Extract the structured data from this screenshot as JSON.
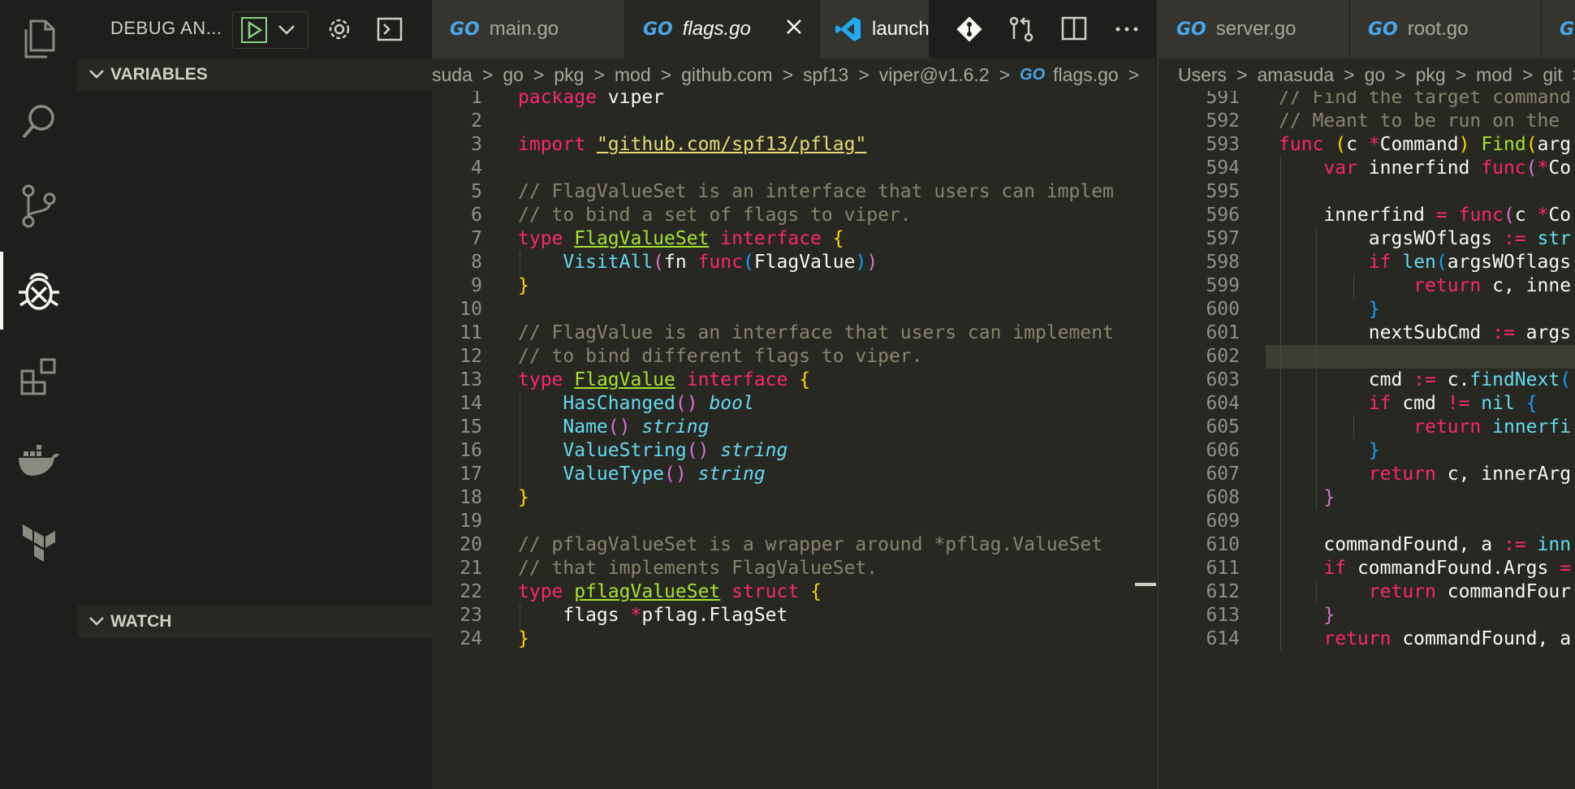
{
  "activity_bar": {
    "items": [
      "explorer-icon",
      "search-icon",
      "source-control-icon",
      "debug-icon",
      "extensions-icon",
      "docker-icon",
      "terraform-icon"
    ],
    "active": "debug-icon"
  },
  "debug": {
    "title": "DEBUG AN...",
    "sections": [
      {
        "label": "VARIABLES"
      },
      {
        "label": "WATCH"
      }
    ]
  },
  "left_editor": {
    "tabs": [
      {
        "label": "main.go",
        "active": false
      },
      {
        "label": "flags.go",
        "active": true
      },
      {
        "label": "launch",
        "active": false
      }
    ],
    "breadcrumb": [
      "suda",
      "go",
      "pkg",
      "mod",
      "github.com",
      "spf13",
      "viper@v1.6.2",
      "flags.go"
    ],
    "line_numbers": [
      "1",
      "2",
      "3",
      "4",
      "5",
      "6",
      "7",
      "8",
      "9",
      "10",
      "11",
      "12",
      "13",
      "14",
      "15",
      "16",
      "17",
      "18",
      "19",
      "20",
      "21",
      "22",
      "23",
      "24"
    ],
    "lines": [
      [
        [
          "kw",
          "package"
        ],
        [
          "pl",
          " viper"
        ]
      ],
      [],
      [
        [
          "kw",
          "import"
        ],
        [
          "pl",
          " "
        ],
        [
          "st",
          "\"github.com/spf13/pflag\"",
          "u"
        ]
      ],
      [],
      [
        [
          "cm",
          "// FlagValueSet is an interface that users can implem"
        ]
      ],
      [
        [
          "cm",
          "// to bind a set of flags to viper."
        ]
      ],
      [
        [
          "kw",
          "type"
        ],
        [
          "pl",
          " "
        ],
        [
          "fn",
          "FlagValueSet",
          "u"
        ],
        [
          "pl",
          " "
        ],
        [
          "kw",
          "interface"
        ],
        [
          "pl",
          " "
        ],
        [
          "br1",
          "{"
        ]
      ],
      [
        [
          "pl",
          "    "
        ],
        [
          "cl",
          "VisitAll"
        ],
        [
          "br2",
          "("
        ],
        [
          "pl",
          "fn "
        ],
        [
          "kw",
          "func"
        ],
        [
          "br3",
          "("
        ],
        [
          "pl",
          "FlagValue"
        ],
        [
          "br3",
          ")"
        ],
        [
          "br2",
          ")"
        ]
      ],
      [
        [
          "br1",
          "}"
        ]
      ],
      [],
      [
        [
          "cm",
          "// FlagValue is an interface that users can implement"
        ]
      ],
      [
        [
          "cm",
          "// to bind different flags to viper."
        ]
      ],
      [
        [
          "kw",
          "type"
        ],
        [
          "pl",
          " "
        ],
        [
          "fn",
          "FlagValue",
          "u"
        ],
        [
          "pl",
          " "
        ],
        [
          "kw",
          "interface"
        ],
        [
          "pl",
          " "
        ],
        [
          "br1",
          "{"
        ]
      ],
      [
        [
          "pl",
          "    "
        ],
        [
          "cl",
          "HasChanged"
        ],
        [
          "br2",
          "()"
        ],
        [
          "pl",
          " "
        ],
        [
          "ty",
          "bool"
        ]
      ],
      [
        [
          "pl",
          "    "
        ],
        [
          "cl",
          "Name"
        ],
        [
          "br2",
          "()"
        ],
        [
          "pl",
          " "
        ],
        [
          "ty",
          "string"
        ]
      ],
      [
        [
          "pl",
          "    "
        ],
        [
          "cl",
          "ValueString"
        ],
        [
          "br2",
          "()"
        ],
        [
          "pl",
          " "
        ],
        [
          "ty",
          "string"
        ]
      ],
      [
        [
          "pl",
          "    "
        ],
        [
          "cl",
          "ValueType"
        ],
        [
          "br2",
          "()"
        ],
        [
          "pl",
          " "
        ],
        [
          "ty",
          "string"
        ]
      ],
      [
        [
          "br1",
          "}"
        ]
      ],
      [],
      [
        [
          "cm",
          "// pflagValueSet is a wrapper around *pflag.ValueSet"
        ]
      ],
      [
        [
          "cm",
          "// that implements FlagValueSet."
        ]
      ],
      [
        [
          "kw",
          "type"
        ],
        [
          "pl",
          " "
        ],
        [
          "fn",
          "pflagValueSet",
          "u"
        ],
        [
          "pl",
          " "
        ],
        [
          "kw",
          "struct"
        ],
        [
          "pl",
          " "
        ],
        [
          "br1",
          "{"
        ]
      ],
      [
        [
          "pl",
          "    flags "
        ],
        [
          "kw",
          "*"
        ],
        [
          "pl",
          "pflag.FlagSet"
        ]
      ],
      [
        [
          "br1",
          "}"
        ]
      ]
    ]
  },
  "right_editor": {
    "tabs": [
      {
        "label": "server.go",
        "active": false
      },
      {
        "label": "root.go",
        "active": false
      }
    ],
    "breadcrumb": [
      "Users",
      "amasuda",
      "go",
      "pkg",
      "mod",
      "git"
    ],
    "line_numbers": [
      "591",
      "592",
      "593",
      "594",
      "595",
      "596",
      "597",
      "598",
      "599",
      "600",
      "601",
      "602",
      "603",
      "604",
      "605",
      "606",
      "607",
      "608",
      "609",
      "610",
      "611",
      "612",
      "613",
      "614"
    ],
    "breakpoint_line": "601",
    "lines": [
      [
        [
          "cm",
          "// Find the target command"
        ]
      ],
      [
        [
          "cm",
          "// Meant to be run on the "
        ]
      ],
      [
        [
          "kw",
          "func"
        ],
        [
          "pl",
          " "
        ],
        [
          "br1",
          "("
        ],
        [
          "pl",
          "c "
        ],
        [
          "kw",
          "*"
        ],
        [
          "pl",
          "Command"
        ],
        [
          "br1",
          ")"
        ],
        [
          "pl",
          " "
        ],
        [
          "fn",
          "Find"
        ],
        [
          "br1",
          "("
        ],
        [
          "pl",
          "arg"
        ]
      ],
      [
        [
          "pl",
          "    "
        ],
        [
          "kw",
          "var"
        ],
        [
          "pl",
          " innerfind "
        ],
        [
          "kw",
          "func"
        ],
        [
          "br2",
          "("
        ],
        [
          "kw",
          "*"
        ],
        [
          "pl",
          "Co"
        ]
      ],
      [],
      [
        [
          "pl",
          "    innerfind "
        ],
        [
          "kw",
          "="
        ],
        [
          "pl",
          " "
        ],
        [
          "kw",
          "func"
        ],
        [
          "br2",
          "("
        ],
        [
          "pl",
          "c "
        ],
        [
          "kw",
          "*"
        ],
        [
          "pl",
          "Co"
        ]
      ],
      [
        [
          "pl",
          "        argsWOflags "
        ],
        [
          "kw",
          ":="
        ],
        [
          "pl",
          " "
        ],
        [
          "cl",
          "str"
        ]
      ],
      [
        [
          "pl",
          "        "
        ],
        [
          "kw",
          "if"
        ],
        [
          "pl",
          " "
        ],
        [
          "cl",
          "len"
        ],
        [
          "br3",
          "("
        ],
        [
          "pl",
          "argsWOflags"
        ]
      ],
      [
        [
          "pl",
          "            "
        ],
        [
          "kw",
          "return"
        ],
        [
          "pl",
          " c, inne"
        ]
      ],
      [
        [
          "pl",
          "        "
        ],
        [
          "br3",
          "}"
        ]
      ],
      [
        [
          "pl",
          "        nextSubCmd "
        ],
        [
          "kw",
          ":="
        ],
        [
          "pl",
          " args"
        ]
      ],
      [],
      [
        [
          "pl",
          "        cmd "
        ],
        [
          "kw",
          ":="
        ],
        [
          "pl",
          " c."
        ],
        [
          "cl",
          "findNext"
        ],
        [
          "br3",
          "("
        ]
      ],
      [
        [
          "pl",
          "        "
        ],
        [
          "kw",
          "if"
        ],
        [
          "pl",
          " cmd "
        ],
        [
          "kw",
          "!="
        ],
        [
          "pl",
          " "
        ],
        [
          "cl",
          "nil"
        ],
        [
          "pl",
          " "
        ],
        [
          "br3",
          "{"
        ]
      ],
      [
        [
          "pl",
          "            "
        ],
        [
          "kw",
          "return"
        ],
        [
          "pl",
          " "
        ],
        [
          "cl",
          "innerfi"
        ]
      ],
      [
        [
          "pl",
          "        "
        ],
        [
          "br3",
          "}"
        ]
      ],
      [
        [
          "pl",
          "        "
        ],
        [
          "kw",
          "return"
        ],
        [
          "pl",
          " c, innerArg"
        ]
      ],
      [
        [
          "pl",
          "    "
        ],
        [
          "br2",
          "}"
        ]
      ],
      [],
      [
        [
          "pl",
          "    commandFound, a "
        ],
        [
          "kw",
          ":="
        ],
        [
          "pl",
          " "
        ],
        [
          "cl",
          "inn"
        ]
      ],
      [
        [
          "pl",
          "    "
        ],
        [
          "kw",
          "if"
        ],
        [
          "pl",
          " commandFound.Args "
        ],
        [
          "kw",
          "="
        ]
      ],
      [
        [
          "pl",
          "        "
        ],
        [
          "kw",
          "return"
        ],
        [
          "pl",
          " commandFour"
        ]
      ],
      [
        [
          "pl",
          "    "
        ],
        [
          "br2",
          "}"
        ]
      ],
      [
        [
          "pl",
          "    "
        ],
        [
          "kw",
          "return"
        ],
        [
          "pl",
          " commandFound, a"
        ]
      ]
    ]
  }
}
